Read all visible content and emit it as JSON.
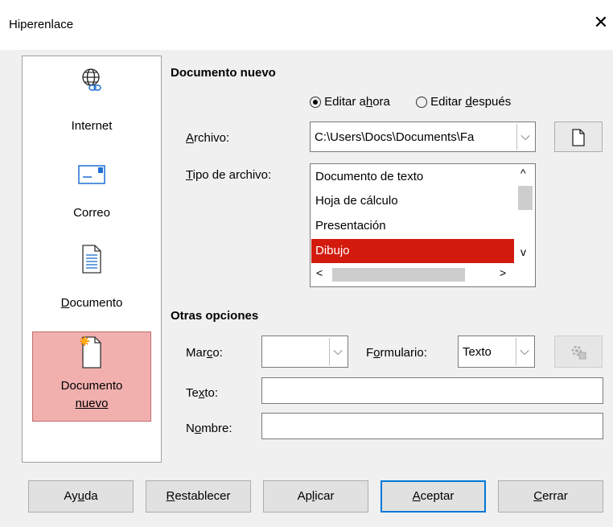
{
  "window": {
    "title": "Hiperenlace"
  },
  "sidebar": {
    "items": [
      {
        "label": "Internet",
        "icon": "globe-link-icon"
      },
      {
        "label": "Correo",
        "icon": "envelope-icon"
      },
      {
        "label": "Documento",
        "icon": "document-icon"
      },
      {
        "label": "Documento nuevo",
        "label_line1": "Documento",
        "label_line2": "nuevo",
        "icon": "new-document-icon",
        "selected": true
      }
    ]
  },
  "new_document": {
    "heading": "Documento nuevo",
    "edit_now": {
      "pre": "Editar a",
      "u": "h",
      "post": "ora"
    },
    "edit_later": {
      "pre": "Editar ",
      "u": "d",
      "post": "espués"
    },
    "file_label": {
      "pre": "",
      "u": "A",
      "post": "rchivo:"
    },
    "file_value": "C:\\Users\\Docs\\Documents\\Fa",
    "filetype_label": {
      "pre": "",
      "u": "T",
      "post": "ipo de archivo:"
    },
    "filetypes": [
      "Documento de texto",
      "Hoja de cálculo",
      "Presentación",
      "Dibujo"
    ],
    "selected_filetype": "Dibujo"
  },
  "other_options": {
    "heading": "Otras opciones",
    "frame_label": {
      "pre": "Mar",
      "u": "c",
      "post": "o:"
    },
    "frame_value": "",
    "form_label": {
      "pre": "F",
      "u": "o",
      "post": "rmulario:"
    },
    "form_value": "Texto",
    "text_label": {
      "pre": "Te",
      "u": "x",
      "post": "to:"
    },
    "text_value": "",
    "name_label": {
      "pre": "N",
      "u": "o",
      "post": "mbre:"
    },
    "name_value": ""
  },
  "buttons": {
    "help": {
      "pre": "Ay",
      "u": "u",
      "post": "da"
    },
    "reset": {
      "pre": "",
      "u": "R",
      "post": "establecer"
    },
    "apply": {
      "pre": "Ap",
      "u": "l",
      "post": "icar"
    },
    "ok": {
      "pre": "",
      "u": "A",
      "post": "ceptar"
    },
    "close": {
      "pre": "",
      "u": "C",
      "post": "errar"
    }
  },
  "colors": {
    "selection_red": "#d21a0d",
    "sidebar_selected": "#f1b0ae",
    "default_button_border": "#0078d7"
  }
}
